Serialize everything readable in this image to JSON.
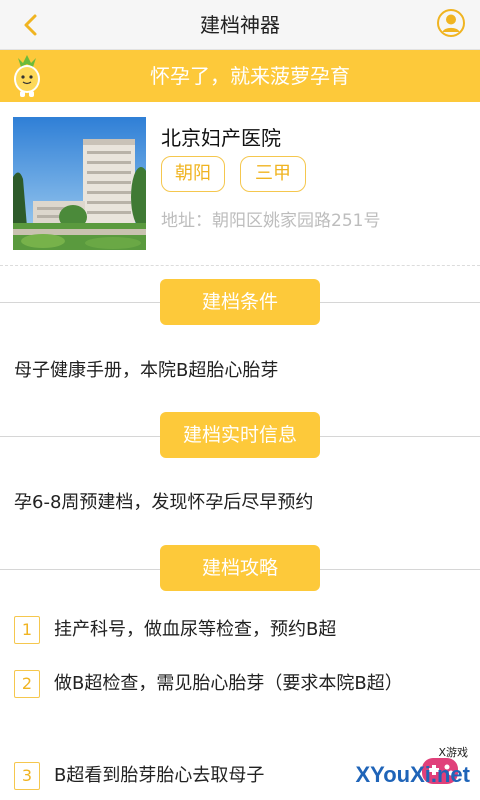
{
  "nav": {
    "title": "建档神器",
    "back_icon": "chevron-left-icon",
    "user_icon": "user-icon"
  },
  "banner": {
    "text": "怀孕了，就来菠萝孕育",
    "logo_icon": "pineapple-icon"
  },
  "hospital": {
    "name": "北京妇产医院",
    "tags": [
      "朝阳",
      "三甲"
    ],
    "address": "地址：朝阳区姚家园路251号"
  },
  "sections": {
    "conditions": {
      "title": "建档条件",
      "text": "母子健康手册，本院B超胎心胎芽"
    },
    "realtime": {
      "title": "建档实时信息",
      "text": "孕6-8周预建档，发现怀孕后尽早预约"
    },
    "guide": {
      "title": "建档攻略",
      "steps": [
        {
          "num": "1",
          "text": "挂产科号，做血尿等检查，预约B超"
        },
        {
          "num": "2",
          "text": "做B超检查，需见胎心胎芽（要求本院B超）"
        },
        {
          "num": "3",
          "text": "B超看到胎芽胎心去取母子"
        }
      ]
    }
  },
  "watermark": {
    "small": "X游戏",
    "text": "XYouXi.net"
  },
  "colors": {
    "accent": "#fdc93a",
    "tag_text": "#f0b421",
    "muted": "#bdbdbd"
  }
}
